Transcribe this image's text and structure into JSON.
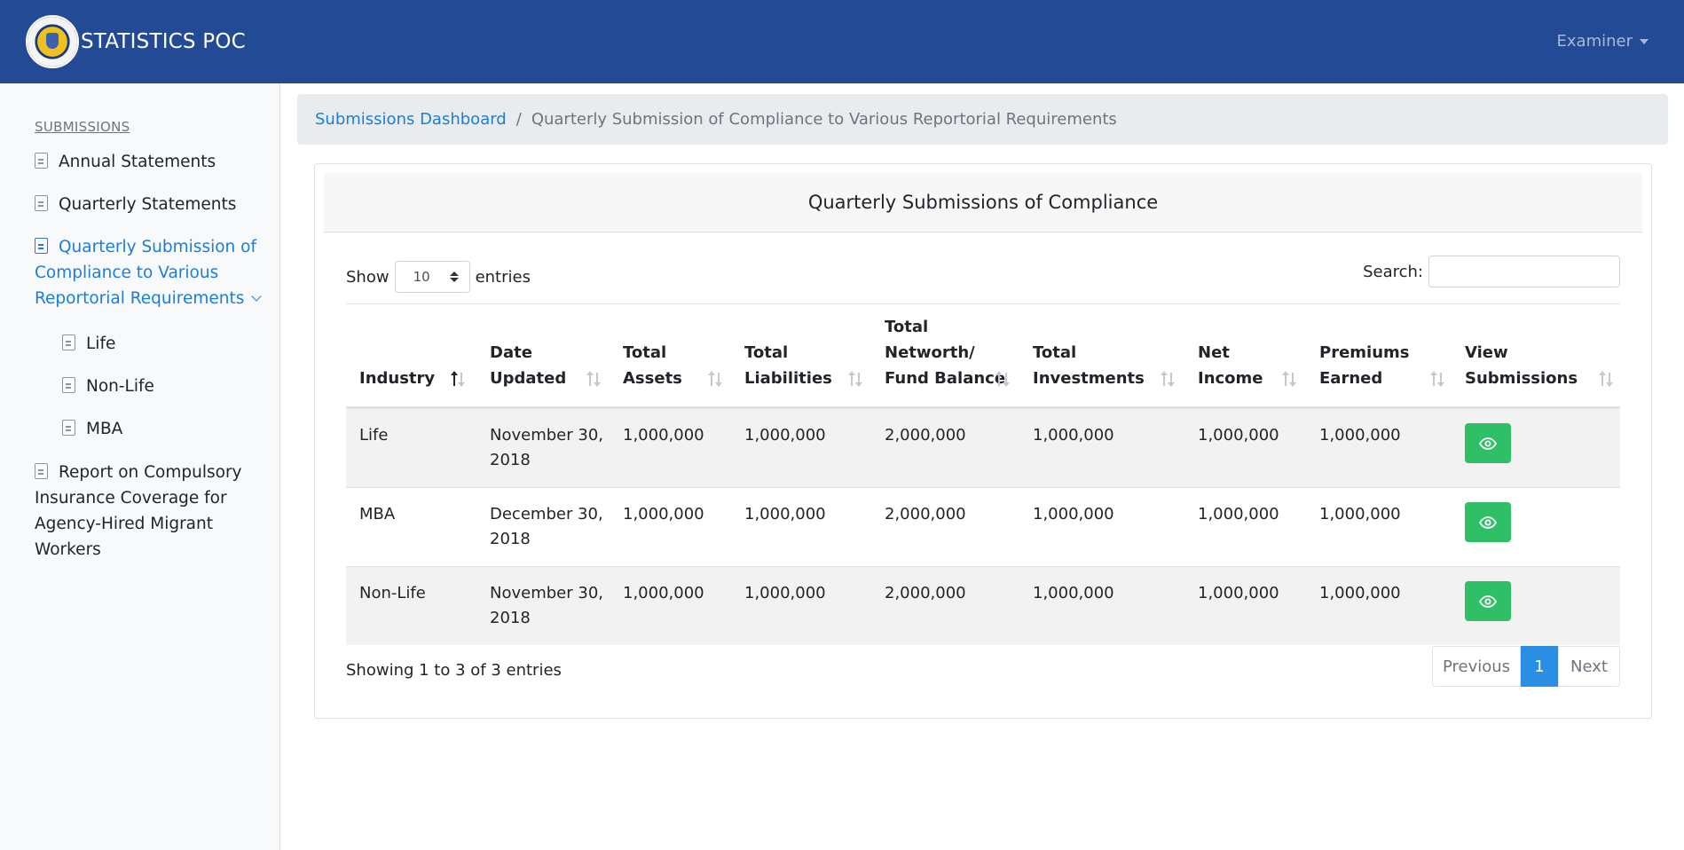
{
  "app": {
    "title": "STATISTICS POC",
    "user_menu": "Examiner"
  },
  "sidebar": {
    "heading": "SUBMISSIONS",
    "items": [
      {
        "label": "Annual Statements"
      },
      {
        "label": "Quarterly Statements"
      },
      {
        "label_lines": [
          "Quarterly Submission of",
          "Compliance to Various",
          "Reportorial Requirements"
        ],
        "active": true,
        "expanded": true
      },
      {
        "label": "Life"
      },
      {
        "label": "Non-Life"
      },
      {
        "label": "MBA"
      },
      {
        "label_lines": [
          "Report on Compulsory",
          "Insurance Coverage for",
          "Agency-Hired Migrant",
          "Workers"
        ]
      }
    ]
  },
  "breadcrumb": {
    "link": "Submissions Dashboard",
    "separator": "/",
    "current": "Quarterly Submission of Compliance to Various Reportorial Requirements"
  },
  "card": {
    "title": "Quarterly Submissions of Compliance"
  },
  "controls": {
    "show_label": "Show",
    "length_value": "10",
    "entries_label": "entries",
    "search_label": "Search:",
    "search_value": ""
  },
  "table": {
    "columns": [
      {
        "lines": [
          "Industry"
        ],
        "sort": "asc"
      },
      {
        "lines": [
          "Date",
          "Updated"
        ],
        "sort": "none"
      },
      {
        "lines": [
          "Total",
          "Assets"
        ],
        "sort": "none"
      },
      {
        "lines": [
          "Total",
          "Liabilities"
        ],
        "sort": "none"
      },
      {
        "lines": [
          "Total",
          "Networth/",
          "Fund Balance"
        ],
        "sort": "none"
      },
      {
        "lines": [
          "Total",
          "Investments"
        ],
        "sort": "none"
      },
      {
        "lines": [
          "Net",
          "Income"
        ],
        "sort": "none"
      },
      {
        "lines": [
          "Premiums",
          "Earned"
        ],
        "sort": "none"
      },
      {
        "lines": [
          "View",
          "Submissions"
        ],
        "sort": "none"
      }
    ],
    "rows": [
      {
        "industry": "Life",
        "date_lines": [
          "November 30,",
          "2018"
        ],
        "total_assets": "1,000,000",
        "total_liabilities": "1,000,000",
        "networth": "2,000,000",
        "investments": "1,000,000",
        "net_income": "1,000,000",
        "premiums": "1,000,000",
        "action_icon": "eye-icon"
      },
      {
        "industry": "MBA",
        "date_lines": [
          "December 30,",
          "2018"
        ],
        "total_assets": "1,000,000",
        "total_liabilities": "1,000,000",
        "networth": "2,000,000",
        "investments": "1,000,000",
        "net_income": "1,000,000",
        "premiums": "1,000,000",
        "action_icon": "eye-icon"
      },
      {
        "industry": "Non-Life",
        "date_lines": [
          "November 30,",
          "2018"
        ],
        "total_assets": "1,000,000",
        "total_liabilities": "1,000,000",
        "networth": "2,000,000",
        "investments": "1,000,000",
        "net_income": "1,000,000",
        "premiums": "1,000,000",
        "action_icon": "eye-icon"
      }
    ]
  },
  "footer": {
    "info": "Showing 1 to 3 of 3 entries",
    "pagination": {
      "previous": "Previous",
      "current": "1",
      "next": "Next"
    }
  },
  "colors": {
    "header": "#234a95",
    "accent": "#1a7ed9",
    "view_button": "#2fbf67",
    "active_page": "#2a8ee4"
  }
}
